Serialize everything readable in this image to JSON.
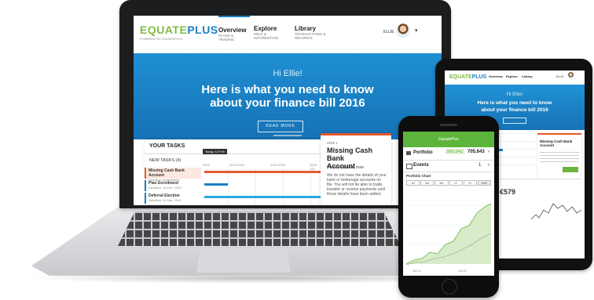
{
  "laptop": {
    "brand": {
      "part1": "EQUATE",
      "part2": "PLUS",
      "tagline": "POWERED BY EQUATEPLUS"
    },
    "nav": [
      {
        "title": "Overview",
        "subtitle": "PLANS & TRADING"
      },
      {
        "title": "Explore",
        "subtitle": "HELP & INFORMATION"
      },
      {
        "title": "Library",
        "subtitle": "TRANSACTIONS & RECORDS"
      }
    ],
    "user": {
      "name": "ELLIE",
      "chevron": "▾"
    },
    "hero": {
      "greeting": "Hi Ellie!",
      "headline_line1": "Here is what you need to know",
      "headline_line2": "about your finance bill 2016",
      "cta": "READ MORE"
    },
    "tasks": {
      "title": "YOUR TASKS",
      "new_tasks": "NEW TASKS (4)",
      "date_badge": "Today, 14 Feb",
      "columns": [
        "2015",
        "2015 2016",
        "2015 2016",
        "2016 201"
      ],
      "items": [
        {
          "title": "Missing Cash Bank Account",
          "subtitle": "Deadline: immediately"
        },
        {
          "title": "Plan Enrollment",
          "subtitle": "Deadline: 14 Feb, 2016"
        },
        {
          "title": "Deferral Election",
          "subtitle": "Deadline: 16 Mar, 2016"
        }
      ]
    },
    "step_panel": {
      "step": "STEP 1",
      "title_line1": "Missing Cash Bank",
      "title_line2": "Account",
      "subtitle": "Please update now",
      "body": "We do not have the details of your bank or brokerage accounts on file. You will not be able to trade, transfer or receive payments until these details have been added."
    }
  },
  "tablet": {
    "brand": {
      "part1": "EQUATE",
      "part2": "PLUS"
    },
    "nav": [
      "Overview",
      "Explore",
      "Library"
    ],
    "user": "ELLIE",
    "hero": {
      "greeting": "Hi Ellie!",
      "headline_line1": "Here is what you need to know",
      "headline_line2": "about your finance bill 2016"
    },
    "panel_title": "Missing Cash Bank Account",
    "value": "€579"
  },
  "phone": {
    "header": "EquatePlus",
    "portfolio": {
      "label": "Portfolio",
      "value": "705,643",
      "highlight": "393,842"
    },
    "events": {
      "label": "Events",
      "count": "1"
    },
    "chart_title": "Portfolio Chart",
    "ranges": [
      "1M",
      "3M",
      "6M",
      "1Y",
      "2Y",
      "MAX"
    ],
    "x_labels": [
      "Jan 14",
      "Jan 15"
    ]
  },
  "colors": {
    "green": "#7fba42",
    "blue": "#1a80c4",
    "orange": "#e55b2d",
    "hero": "#1f8fd2"
  }
}
